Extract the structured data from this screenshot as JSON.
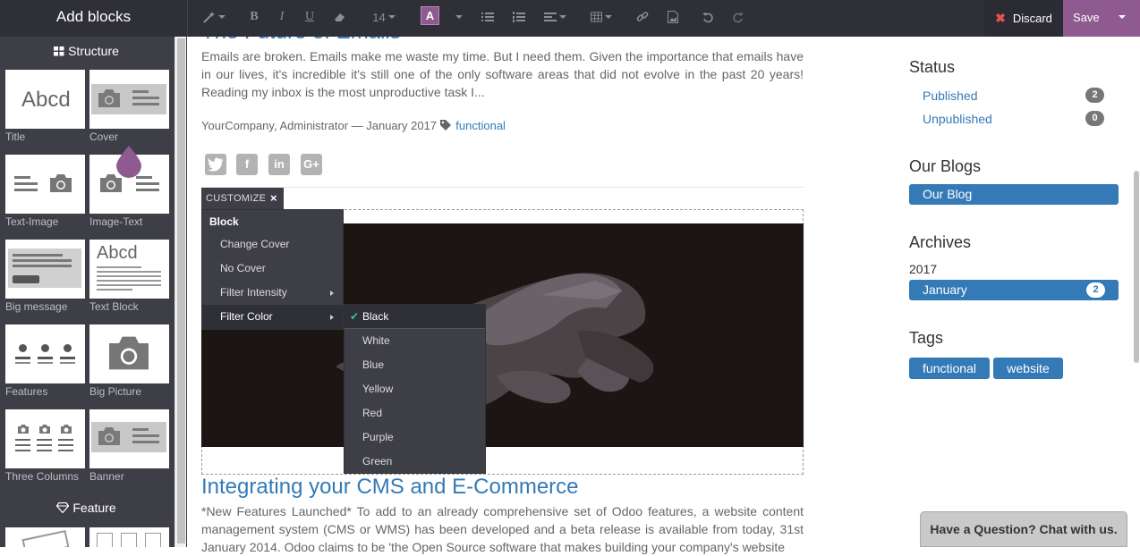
{
  "topbar": {
    "title": "Add blocks",
    "font_size": "14",
    "color_letter": "A",
    "discard_label": "Discard",
    "save_label": "Save"
  },
  "sidebar": {
    "section_structure": "Structure",
    "section_feature": "Feature",
    "snippets": [
      {
        "label": "Title"
      },
      {
        "label": "Cover"
      },
      {
        "label": "Text-Image"
      },
      {
        "label": "Image-Text"
      },
      {
        "label": "Big message"
      },
      {
        "label": "Text Block"
      },
      {
        "label": "Features"
      },
      {
        "label": "Big Picture"
      },
      {
        "label": "Three Columns"
      },
      {
        "label": "Banner"
      }
    ],
    "thumb_text": "Abcd"
  },
  "post1": {
    "title": "The Future of Emails",
    "teaser": "Emails are broken. Emails make me waste my time. But I need them. Given the importance that emails have in our lives, it's incredible it's still one of the only software areas that did not evolve in the past 20 years! Reading my inbox is the most unproductive task I...",
    "meta": "YourCompany, Administrator — January 2017",
    "tag": "functional"
  },
  "customize": {
    "label": "CUSTOMIZE",
    "close": "×",
    "menu_header": "Block",
    "menu_items": [
      "Change Cover",
      "No Cover",
      "Filter Intensity",
      "Filter Color"
    ],
    "filter_colors": [
      "Black",
      "White",
      "Blue",
      "Yellow",
      "Red",
      "Purple",
      "Green"
    ],
    "selected_color": "Black"
  },
  "post2": {
    "title": "Integrating your CMS and E-Commerce",
    "teaser": "*New Features Launched* To add to an already comprehensive set of Odoo features, a website content management system (CMS or WMS) has been developed and a beta release is available from today, 31st January 2014. Odoo claims to be 'the Open Source software that makes building your company's website"
  },
  "right": {
    "status_heading": "Status",
    "published_label": "Published",
    "published_count": "2",
    "unpublished_label": "Unpublished",
    "unpublished_count": "0",
    "blogs_heading": "Our Blogs",
    "blog_name": "Our Blog",
    "archives_heading": "Archives",
    "archive_year": "2017",
    "archive_month": "January",
    "archive_count": "2",
    "tags_heading": "Tags",
    "tags": [
      "functional",
      "website"
    ]
  },
  "chat_label": "Have a Question? Chat with us.",
  "colors": {
    "accent": "#8e5a8f",
    "link": "#337ab7",
    "toolbar": "#2f2f38",
    "sidebar": "#3e3e46"
  }
}
